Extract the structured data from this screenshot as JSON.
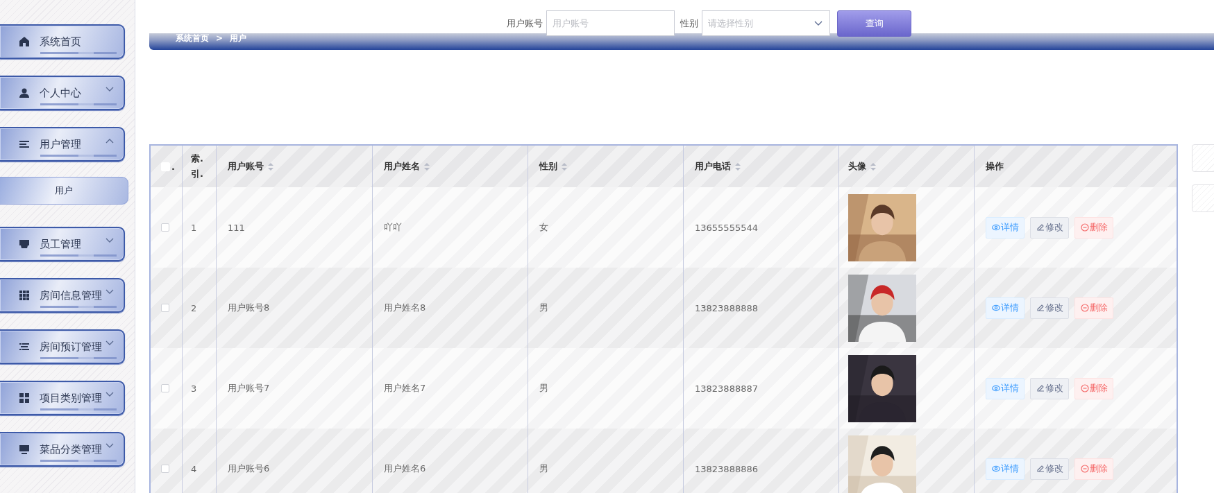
{
  "sidebar": {
    "items": [
      {
        "label": "系统首页"
      },
      {
        "label": "个人中心",
        "expanded": false
      },
      {
        "label": "用户管理",
        "expanded": true,
        "children": [
          {
            "label": "用户"
          }
        ]
      },
      {
        "label": "员工管理",
        "expanded": false
      },
      {
        "label": "房间信息管理",
        "expanded": false
      },
      {
        "label": "房间预订管理",
        "expanded": false
      },
      {
        "label": "项目类别管理",
        "expanded": false
      },
      {
        "label": "菜品分类管理",
        "expanded": false
      }
    ]
  },
  "search": {
    "fields": [
      {
        "label": "用户账号",
        "kind": "input",
        "placeholder": "用户账号"
      },
      {
        "label": "性别",
        "kind": "select",
        "placeholder": "请选择性别"
      }
    ],
    "button": "查询"
  },
  "breadcrumb": {
    "items": [
      "系统首页",
      "用户"
    ],
    "separator": ">"
  },
  "table": {
    "select_all": {
      "checked": false,
      "suffix": "."
    },
    "columns": [
      {
        "label": "索.引.",
        "sortable": false
      },
      {
        "label": "用户账号",
        "sortable": true
      },
      {
        "label": "用户姓名",
        "sortable": true
      },
      {
        "label": "性别",
        "sortable": true
      },
      {
        "label": "用户电话",
        "sortable": true
      },
      {
        "label": "头像",
        "sortable": true
      },
      {
        "label": "操作",
        "sortable": false
      }
    ],
    "rows": [
      {
        "checked": false,
        "cells": [
          "1",
          "111",
          "吖吖",
          "女",
          "13655555544"
        ],
        "avatar": {
          "kind": "picture"
        },
        "actions": [
          {
            "label": "详情",
            "kind": "view"
          },
          {
            "label": "修改",
            "kind": "edit"
          },
          {
            "label": "删除",
            "kind": "delete"
          }
        ]
      },
      {
        "checked": false,
        "cells": [
          "2",
          "用户账号8",
          "用户姓名8",
          "男",
          "13823888888"
        ],
        "avatar": {
          "kind": "picture"
        },
        "actions": [
          {
            "label": "详情",
            "kind": "view"
          },
          {
            "label": "修改",
            "kind": "edit"
          },
          {
            "label": "删除",
            "kind": "delete"
          }
        ]
      },
      {
        "checked": false,
        "cells": [
          "3",
          "用户账号7",
          "用户姓名7",
          "男",
          "13823888887"
        ],
        "avatar": {
          "kind": "picture"
        },
        "actions": [
          {
            "label": "详情",
            "kind": "view"
          },
          {
            "label": "修改",
            "kind": "edit"
          },
          {
            "label": "删除",
            "kind": "delete"
          }
        ]
      },
      {
        "checked": false,
        "cells": [
          "4",
          "用户账号6",
          "用户姓名6",
          "男",
          "13823888886"
        ],
        "avatar": {
          "kind": "picture"
        },
        "actions": [
          {
            "label": "详情",
            "kind": "view"
          },
          {
            "label": "修改",
            "kind": "edit"
          },
          {
            "label": "删除",
            "kind": "delete"
          }
        ]
      }
    ]
  }
}
